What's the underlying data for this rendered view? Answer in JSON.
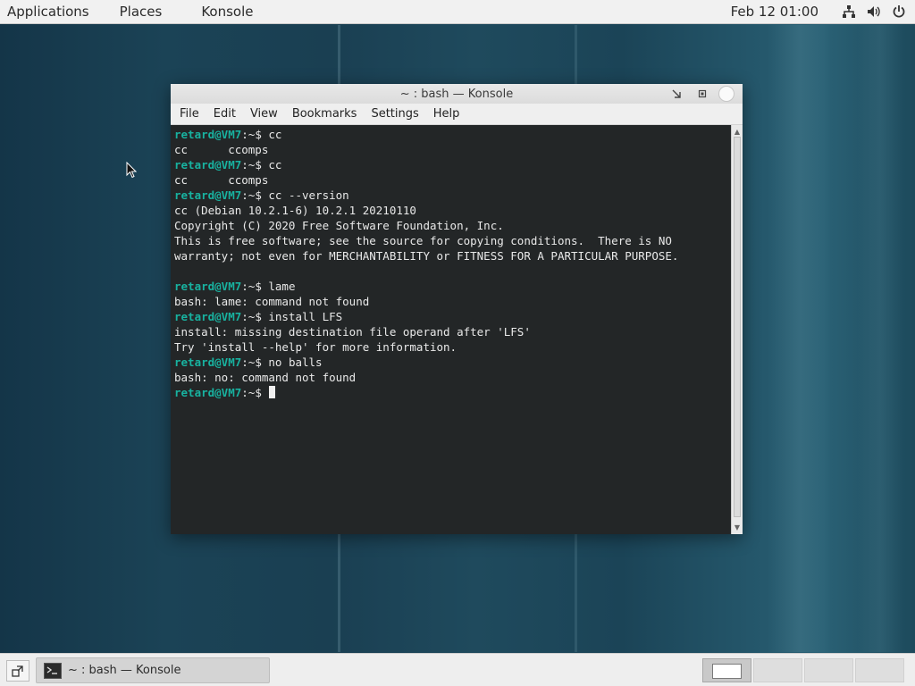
{
  "top_panel": {
    "menus": [
      "Applications",
      "Places",
      "Konsole"
    ],
    "clock": "Feb 12  01:00",
    "tray_icons": [
      "network-icon",
      "volume-icon",
      "power-icon"
    ]
  },
  "window": {
    "title": "~ : bash — Konsole",
    "menubar": [
      "File",
      "Edit",
      "View",
      "Bookmarks",
      "Settings",
      "Help"
    ],
    "prompt": "retard@VM7",
    "prompt_suffix": ":~$ ",
    "terminal_lines": [
      {
        "type": "cmd",
        "text": "cc"
      },
      {
        "type": "out",
        "text": "cc      ccomps"
      },
      {
        "type": "cmd",
        "text": "cc"
      },
      {
        "type": "out",
        "text": "cc      ccomps"
      },
      {
        "type": "cmd",
        "text": "cc --version"
      },
      {
        "type": "out",
        "text": "cc (Debian 10.2.1-6) 10.2.1 20210110"
      },
      {
        "type": "out",
        "text": "Copyright (C) 2020 Free Software Foundation, Inc."
      },
      {
        "type": "out",
        "text": "This is free software; see the source for copying conditions.  There is NO"
      },
      {
        "type": "out",
        "text": "warranty; not even for MERCHANTABILITY or FITNESS FOR A PARTICULAR PURPOSE."
      },
      {
        "type": "out",
        "text": ""
      },
      {
        "type": "cmd",
        "text": "lame"
      },
      {
        "type": "out",
        "text": "bash: lame: command not found"
      },
      {
        "type": "cmd",
        "text": "install LFS"
      },
      {
        "type": "out",
        "text": "install: missing destination file operand after 'LFS'"
      },
      {
        "type": "out",
        "text": "Try 'install --help' for more information."
      },
      {
        "type": "cmd",
        "text": "no balls"
      },
      {
        "type": "out",
        "text": "bash: no: command not found"
      },
      {
        "type": "cmd",
        "text": "",
        "cursor": true
      }
    ]
  },
  "taskbar": {
    "task_label": "~ : bash — Konsole",
    "workspaces": 4,
    "active_workspace": 1
  },
  "colors": {
    "prompt": "#18b2a0",
    "terminal_bg": "#232627",
    "terminal_fg": "#e9e9e9",
    "panel_bg": "#f1f1f1"
  }
}
